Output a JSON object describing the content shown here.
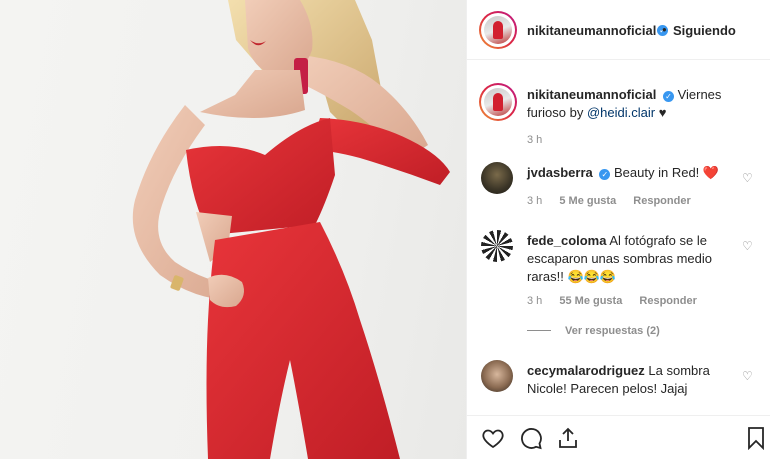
{
  "post": {
    "author": "nikitaneumannoficial",
    "follow_state": "Siguiendo",
    "caption_text": "Viernes furioso by ",
    "caption_mention": "@heidi.clair",
    "caption_heart": "♥",
    "time": "3 h"
  },
  "comments": [
    {
      "user": "jvdasberra",
      "verified": true,
      "text": "Beauty in Red! ❤️",
      "time": "3 h",
      "likes": "5 Me gusta",
      "reply": "Responder"
    },
    {
      "user": "fede_coloma",
      "verified": false,
      "text": "Al fotógrafo se le escaparon unas sombras medio raras!! 😂😂😂",
      "time": "3 h",
      "likes": "55 Me gusta",
      "reply": "Responder",
      "view_replies": "Ver respuestas (2)"
    },
    {
      "user": "cecymalarodriguez",
      "verified": false,
      "text": "La sombra Nicole! Parecen pelos! Jajaj"
    }
  ],
  "icons": {
    "verified": "✓",
    "more": "•",
    "like": "heart-icon",
    "comment": "comment-icon",
    "share": "share-icon",
    "save": "bookmark-icon"
  },
  "colors": {
    "dress": "#d62a2f",
    "link": "#003569",
    "muted": "#8e8e8e",
    "verified": "#3897f0"
  }
}
